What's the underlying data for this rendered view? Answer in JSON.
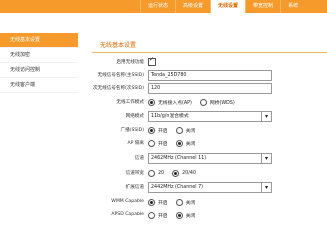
{
  "topbar": {
    "tabs": [
      "运行状态",
      "高级设置",
      "无线设置",
      "带宽控制",
      "系统"
    ],
    "active_tab": 2
  },
  "sidebar": {
    "items": [
      "无线基本设置",
      "无线加密",
      "无线访问控制",
      "无线客户端"
    ],
    "active_index": 0
  },
  "main": {
    "title": "无线基本设置",
    "rows": {
      "enable_wireless": {
        "label": "启用无线功能",
        "checked": true
      },
      "ssid1": {
        "label": "无线信号名称(主SSID)",
        "value": "Tenda_25D780"
      },
      "ssid2": {
        "label": "次无线信号名称(次SSID)",
        "value": "120"
      },
      "work_mode": {
        "label": "无线工作模式",
        "opt1": "无线接入点(AP)",
        "opt2": "网桥(WDS)"
      },
      "network_mode": {
        "label": "网络模式",
        "value": "11b/g/n混合模式"
      },
      "ssid_broadcast": {
        "label": "广播(SSID)",
        "opt1": "开启",
        "opt2": "关闭"
      },
      "ap_isolation": {
        "label": "AP 隔离",
        "opt1": "开启",
        "opt2": "关闭"
      },
      "channel": {
        "label": "信道",
        "value": "2462MHz (Channel 11)"
      },
      "bandwidth": {
        "label": "信道带宽",
        "opt1": "20",
        "opt2": "20/40"
      },
      "ext_channel": {
        "label": "扩展信道",
        "value": "2442MHz (Channel 7)"
      },
      "wmm": {
        "label": "WMM Capable",
        "opt1": "开启",
        "opt2": "关闭"
      },
      "apsd": {
        "label": "APSD Capable",
        "opt1": "开启",
        "opt2": "关闭"
      }
    }
  }
}
